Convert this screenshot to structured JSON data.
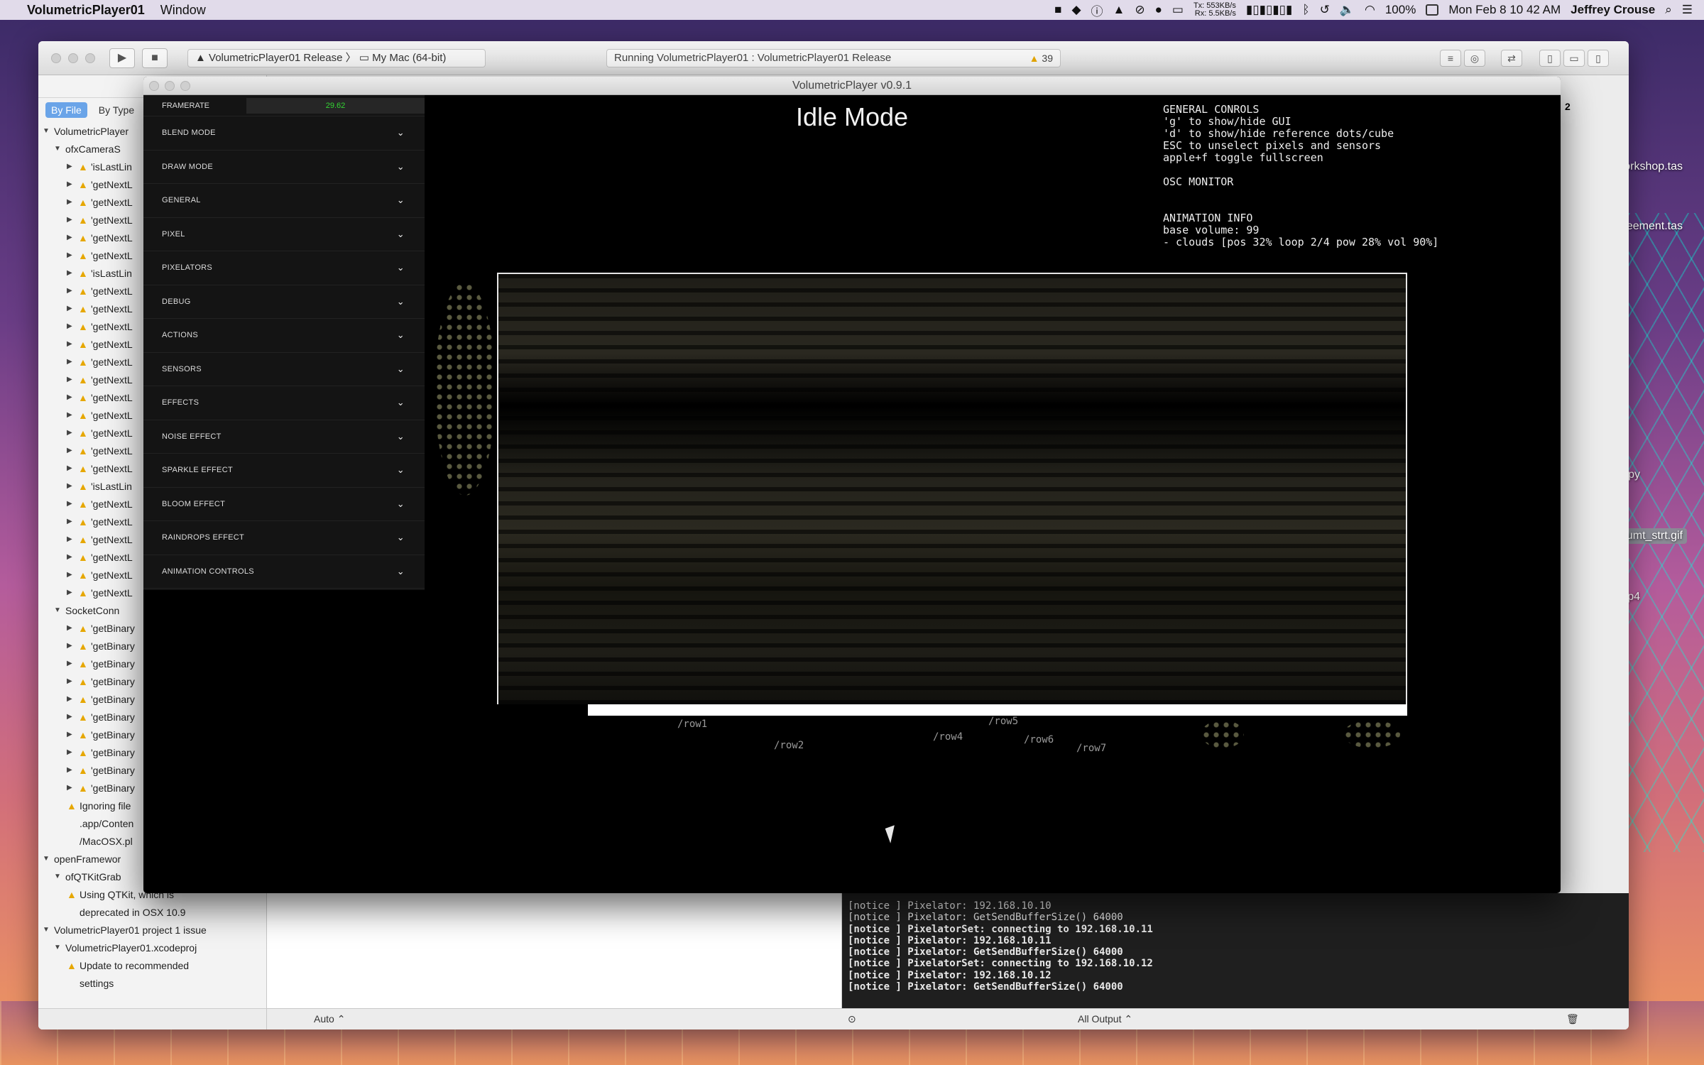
{
  "menubar": {
    "app_name": "VolumetricPlayer01",
    "menu": "Window",
    "net_tx": "553KB/s",
    "net_rx": "5.5KB/s",
    "battery": "100%",
    "datetime": "Mon Feb 8  10 42 AM",
    "user": "Jeffrey Crouse"
  },
  "xcode": {
    "scheme": "VolumetricPlayer01 Release",
    "destination": "My Mac (64-bit)",
    "status": "Running VolumetricPlayer01 : VolumetricPlayer01 Release",
    "warning_count": "39",
    "filter_by_file": "By File",
    "filter_by_type": "By Type",
    "navigator": {
      "root": "VolumetricPlayer",
      "group1": "ofxCameraS",
      "items1": [
        "'isLastLin",
        "'getNextL",
        "'getNextL",
        "'getNextL",
        "'getNextL",
        "'getNextL",
        "'isLastLin",
        "'getNextL",
        "'getNextL",
        "'getNextL",
        "'getNextL",
        "'getNextL",
        "'getNextL",
        "'getNextL",
        "'getNextL",
        "'getNextL",
        "'getNextL",
        "'getNextL",
        "'isLastLin",
        "'getNextL",
        "'getNextL",
        "'getNextL",
        "'getNextL",
        "'getNextL",
        "'getNextL"
      ],
      "group2": "SocketConn",
      "items2": [
        "'getBinary",
        "'getBinary",
        "'getBinary",
        "'getBinary",
        "'getBinary",
        "'getBinary",
        "'getBinary",
        "'getBinary",
        "'getBinary",
        "'getBinary"
      ],
      "ignoring1": "Ignoring file",
      "ignoring2": ".app/Conten",
      "ignoring3": "/MacOSX.pl",
      "group3": "openFramewor",
      "group3_child": "ofQTKitGrab",
      "qtkit1": "Using QTKit, which is",
      "qtkit2": "deprecated in OSX 10.9",
      "project": "VolumetricPlayer01 project",
      "project_issue": "1 issue",
      "xcodeproj": "VolumetricPlayer01.xcodeproj",
      "update1": "Update to recommended",
      "update2": "settings"
    },
    "console_lines": [
      "[notice ] Pixelator: 192.168.10.10",
      "[notice ] Pixelator: GetSendBufferSize() 64000",
      "[notice ] PixelatorSet: connecting to 192.168.10.11",
      "[notice ] Pixelator: 192.168.10.11",
      "[notice ] Pixelator: GetSendBufferSize() 64000",
      "[notice ] PixelatorSet: connecting to 192.168.10.12",
      "[notice ] Pixelator: 192.168.10.12",
      "[notice ] Pixelator: GetSendBufferSize() 64000"
    ],
    "debug_auto": "Auto ⌃",
    "output_select": "All Output ⌃",
    "tab_count": "2"
  },
  "player": {
    "window_title": "VolumetricPlayer v0.9.1",
    "mode": "Idle Mode",
    "framerate_label": "FRAMERATE",
    "framerate_value": "29.62",
    "gui_sections": [
      "BLEND MODE",
      "DRAW MODE",
      "GENERAL",
      "PIXEL",
      "PIXELATORS",
      "DEBUG",
      "ACTIONS",
      "SENSORS",
      "EFFECTS",
      "NOISE EFFECT",
      "SPARKLE EFFECT",
      "BLOOM EFFECT",
      "RAINDROPS EFFECT",
      "ANIMATION CONTROLS"
    ],
    "info": {
      "general_title": "GENERAL CONROLS",
      "line1": "'g' to show/hide GUI",
      "line2": "'d' to show/hide reference dots/cube",
      "line3": "ESC to unselect pixels and sensors",
      "line4": "apple+f toggle fullscreen",
      "osc_title": "OSC MONITOR",
      "anim_title": "ANIMATION INFO",
      "anim_line1": "base volume: 99",
      "anim_line2": "- clouds [pos 32% loop 2/4 pow 28% vol 90%]"
    },
    "row_labels": [
      "/row1",
      "/row2",
      "/row4",
      "/row5",
      "/row6",
      "/row7"
    ],
    "progress": 0.1
  },
  "desktop": {
    "labels": [
      "orkshop.tas",
      "greement.tas",
      "py",
      "umt_strt.gif",
      "p4"
    ]
  }
}
